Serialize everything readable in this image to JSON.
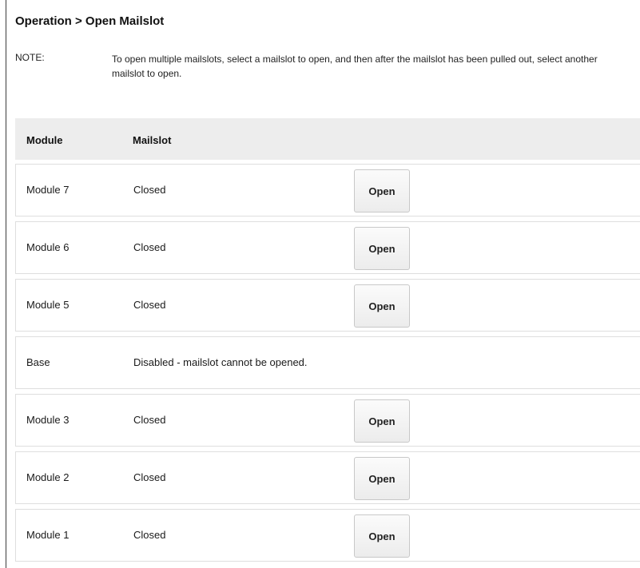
{
  "page": {
    "title": "Operation > Open Mailslot"
  },
  "note": {
    "label": "NOTE:",
    "text": "To open multiple mailslots, select a mailslot to open, and then after the mailslot has been pulled out, select another mailslot to open."
  },
  "table": {
    "headers": {
      "module": "Module",
      "mailslot": "Mailslot"
    },
    "rows": [
      {
        "module": "Module 7",
        "status": "Closed",
        "button": "Open"
      },
      {
        "module": "Module 6",
        "status": "Closed",
        "button": "Open"
      },
      {
        "module": "Module 5",
        "status": "Closed",
        "button": "Open"
      },
      {
        "module": "Base",
        "status": "Disabled - mailslot cannot be opened."
      },
      {
        "module": "Module 3",
        "status": "Closed",
        "button": "Open"
      },
      {
        "module": "Module 2",
        "status": "Closed",
        "button": "Open"
      },
      {
        "module": "Module 1",
        "status": "Closed",
        "button": "Open"
      }
    ]
  }
}
